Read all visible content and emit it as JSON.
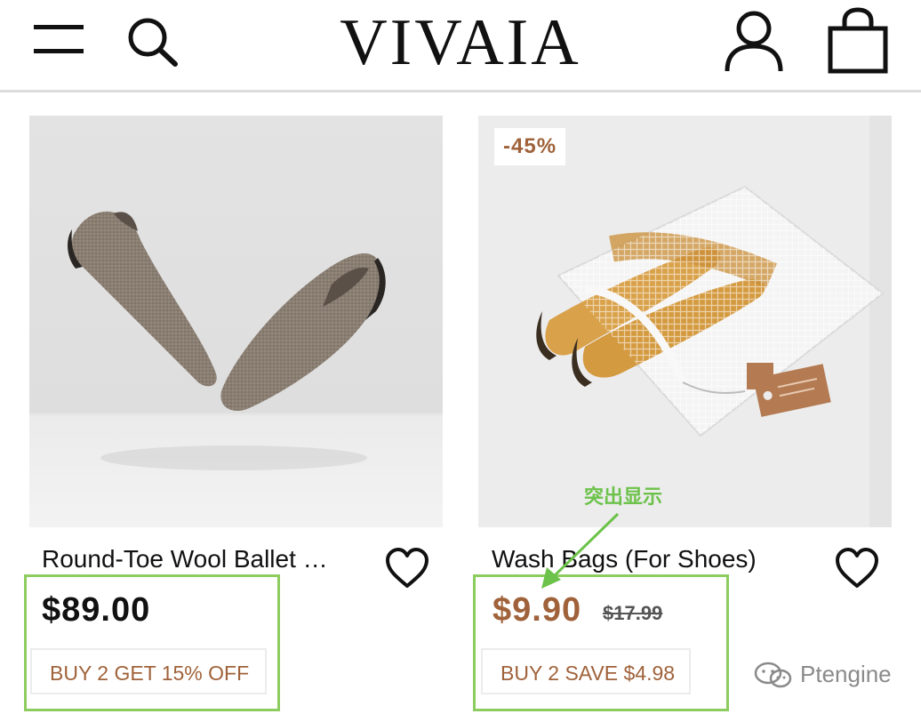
{
  "header": {
    "brand": "VIVAIA",
    "menu_icon": "hamburger-menu-icon",
    "search_icon": "search-icon",
    "account_icon": "user-account-icon",
    "cart_icon": "shopping-bag-icon"
  },
  "products": [
    {
      "title": "Round-Toe Wool Ballet …",
      "price": "$89.00",
      "promo": "BUY 2 GET 15% OFF",
      "image": "taupe-knit-ballet-flats-photo"
    },
    {
      "badge": "-45%",
      "title": "Wash Bags (For Shoes)",
      "price": "$9.90",
      "original_price": "$17.99",
      "promo": "BUY 2 SAVE $4.98",
      "image": "mesh-wash-bag-with-yellow-flats-photo"
    }
  ],
  "annotation": {
    "label": "突出显示"
  },
  "watermark": {
    "text": "Ptengine",
    "icon": "wechat-icon"
  },
  "colors": {
    "sale_price": "#a0623a",
    "promo_text": "#a0623a",
    "highlight": "#8dcc5e",
    "annotation": "#6cc24a"
  }
}
